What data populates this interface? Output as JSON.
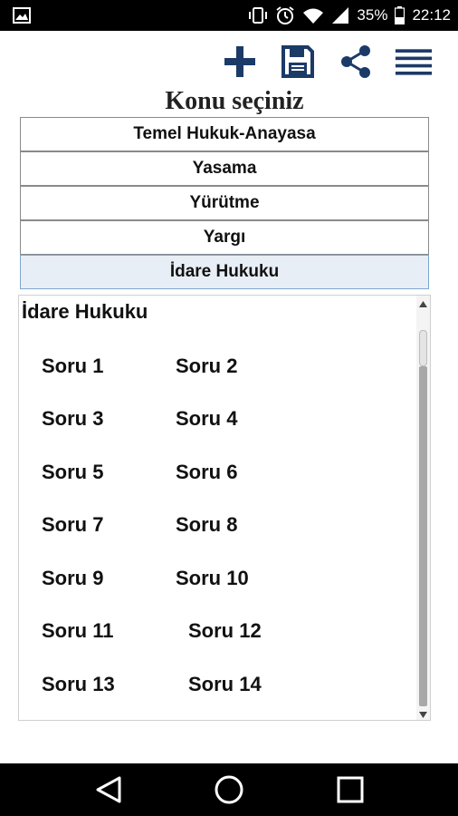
{
  "status_bar": {
    "battery": "35%",
    "time": "22:12",
    "icons": [
      "image-icon",
      "vibrate-icon",
      "alarm-icon",
      "wifi-icon",
      "signal-icon",
      "battery-icon"
    ]
  },
  "toolbar": {
    "buttons": [
      "plus-icon",
      "save-icon",
      "share-icon",
      "menu-icon"
    ],
    "color": "#1b3a68"
  },
  "header": {
    "title": "Konu seçiniz"
  },
  "topics": [
    {
      "label": "Temel Hukuk-Anayasa",
      "selected": false
    },
    {
      "label": "Yasama",
      "selected": false
    },
    {
      "label": "Yürütme",
      "selected": false
    },
    {
      "label": "Yargı",
      "selected": false
    },
    {
      "label": "İdare Hukuku",
      "selected": true
    }
  ],
  "content": {
    "title": "İdare Hukuku",
    "questions": [
      "Soru 1",
      "Soru 2",
      "Soru 3",
      "Soru 4",
      "Soru 5",
      "Soru 6",
      "Soru 7",
      "Soru 8",
      "Soru 9",
      "Soru 10",
      "Soru 11",
      "Soru 12",
      "Soru 13",
      "Soru 14"
    ]
  },
  "nav_bar": {
    "buttons": [
      "back-icon",
      "home-icon",
      "recents-icon"
    ]
  }
}
